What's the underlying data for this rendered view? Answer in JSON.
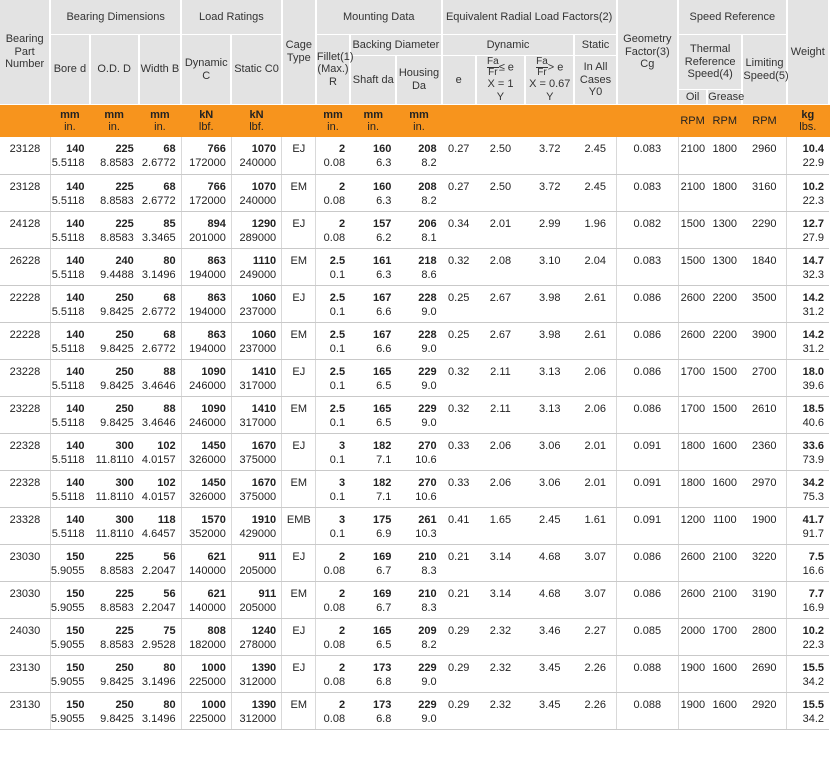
{
  "headers": {
    "part_number": "Bearing Part Number",
    "bearing_dimensions": "Bearing Dimensions",
    "load_ratings": "Load Ratings",
    "cage_type": "Cage Type",
    "mounting_data": "Mounting Data",
    "eq_radial_load_factors": "Equivalent Radial Load Factors(2)",
    "speed_reference": "Speed Reference",
    "geometry_factor": "Geometry Factor(3) Cg",
    "weight": "Weight",
    "bore": "Bore d",
    "od": "O.D. D",
    "width": "Width B",
    "dynamic_c": "Dynamic C",
    "static_c0": "Static C0",
    "fillet": "Fillet(1) (Max.) R",
    "backing_diameter": "Backing Diameter",
    "shaft": "Shaft da",
    "housing": "Housing Da",
    "dynamic": "Dynamic",
    "static": "Static",
    "e": "e",
    "fa_le_e": "≤ e",
    "fa_gt_e": "> e",
    "x1": "X = 1",
    "x067": "X = 0.67",
    "y": "Y",
    "in_all_cases": "In All Cases",
    "y0": "Y0",
    "thermal_ref": "Thermal Reference Speed(4)",
    "limiting": "Limiting Speed(5)",
    "oil": "Oil",
    "grease": "Grease",
    "fa": "Fa",
    "fr": "Fr"
  },
  "units": {
    "bore": [
      "mm",
      "in."
    ],
    "od": [
      "mm",
      "in."
    ],
    "width": [
      "mm",
      "in."
    ],
    "dynamic": [
      "kN",
      "lbf."
    ],
    "static": [
      "kN",
      "lbf."
    ],
    "fillet": [
      "mm",
      "in."
    ],
    "shaft": [
      "mm",
      "in."
    ],
    "housing": [
      "mm",
      "in."
    ],
    "rpm_oil": "RPM",
    "rpm_grease": "RPM",
    "rpm_limit": "RPM",
    "weight": [
      "kg",
      "lbs."
    ]
  },
  "rows": [
    {
      "part": "23128",
      "bore": [
        "140",
        "5.5118"
      ],
      "od": [
        "225",
        "8.8583"
      ],
      "width": [
        "68",
        "2.6772"
      ],
      "dyn": [
        "766",
        "172000"
      ],
      "stat": [
        "1070",
        "240000"
      ],
      "cage": "EJ",
      "fillet": [
        "2",
        "0.08"
      ],
      "shaft": [
        "160",
        "6.3"
      ],
      "housing": [
        "208",
        "8.2"
      ],
      "e": "0.27",
      "y1": "2.50",
      "y2": "3.72",
      "y0": "2.45",
      "cg": "0.083",
      "oil": "2100",
      "grease": "1800",
      "limit": "2960",
      "wt": [
        "10.4",
        "22.9"
      ]
    },
    {
      "part": "23128",
      "bore": [
        "140",
        "5.5118"
      ],
      "od": [
        "225",
        "8.8583"
      ],
      "width": [
        "68",
        "2.6772"
      ],
      "dyn": [
        "766",
        "172000"
      ],
      "stat": [
        "1070",
        "240000"
      ],
      "cage": "EM",
      "fillet": [
        "2",
        "0.08"
      ],
      "shaft": [
        "160",
        "6.3"
      ],
      "housing": [
        "208",
        "8.2"
      ],
      "e": "0.27",
      "y1": "2.50",
      "y2": "3.72",
      "y0": "2.45",
      "cg": "0.083",
      "oil": "2100",
      "grease": "1800",
      "limit": "3160",
      "wt": [
        "10.2",
        "22.3"
      ]
    },
    {
      "part": "24128",
      "bore": [
        "140",
        "5.5118"
      ],
      "od": [
        "225",
        "8.8583"
      ],
      "width": [
        "85",
        "3.3465"
      ],
      "dyn": [
        "894",
        "201000"
      ],
      "stat": [
        "1290",
        "289000"
      ],
      "cage": "EJ",
      "fillet": [
        "2",
        "0.08"
      ],
      "shaft": [
        "157",
        "6.2"
      ],
      "housing": [
        "206",
        "8.1"
      ],
      "e": "0.34",
      "y1": "2.01",
      "y2": "2.99",
      "y0": "1.96",
      "cg": "0.082",
      "oil": "1500",
      "grease": "1300",
      "limit": "2290",
      "wt": [
        "12.7",
        "27.9"
      ]
    },
    {
      "part": "26228",
      "bore": [
        "140",
        "5.5118"
      ],
      "od": [
        "240",
        "9.4488"
      ],
      "width": [
        "80",
        "3.1496"
      ],
      "dyn": [
        "863",
        "194000"
      ],
      "stat": [
        "1110",
        "249000"
      ],
      "cage": "EM",
      "fillet": [
        "2.5",
        "0.1"
      ],
      "shaft": [
        "161",
        "6.3"
      ],
      "housing": [
        "218",
        "8.6"
      ],
      "e": "0.32",
      "y1": "2.08",
      "y2": "3.10",
      "y0": "2.04",
      "cg": "0.083",
      "oil": "1500",
      "grease": "1300",
      "limit": "1840",
      "wt": [
        "14.7",
        "32.3"
      ]
    },
    {
      "part": "22228",
      "bore": [
        "140",
        "5.5118"
      ],
      "od": [
        "250",
        "9.8425"
      ],
      "width": [
        "68",
        "2.6772"
      ],
      "dyn": [
        "863",
        "194000"
      ],
      "stat": [
        "1060",
        "237000"
      ],
      "cage": "EJ",
      "fillet": [
        "2.5",
        "0.1"
      ],
      "shaft": [
        "167",
        "6.6"
      ],
      "housing": [
        "228",
        "9.0"
      ],
      "e": "0.25",
      "y1": "2.67",
      "y2": "3.98",
      "y0": "2.61",
      "cg": "0.086",
      "oil": "2600",
      "grease": "2200",
      "limit": "3500",
      "wt": [
        "14.2",
        "31.2"
      ]
    },
    {
      "part": "22228",
      "bore": [
        "140",
        "5.5118"
      ],
      "od": [
        "250",
        "9.8425"
      ],
      "width": [
        "68",
        "2.6772"
      ],
      "dyn": [
        "863",
        "194000"
      ],
      "stat": [
        "1060",
        "237000"
      ],
      "cage": "EM",
      "fillet": [
        "2.5",
        "0.1"
      ],
      "shaft": [
        "167",
        "6.6"
      ],
      "housing": [
        "228",
        "9.0"
      ],
      "e": "0.25",
      "y1": "2.67",
      "y2": "3.98",
      "y0": "2.61",
      "cg": "0.086",
      "oil": "2600",
      "grease": "2200",
      "limit": "3900",
      "wt": [
        "14.2",
        "31.2"
      ]
    },
    {
      "part": "23228",
      "bore": [
        "140",
        "5.5118"
      ],
      "od": [
        "250",
        "9.8425"
      ],
      "width": [
        "88",
        "3.4646"
      ],
      "dyn": [
        "1090",
        "246000"
      ],
      "stat": [
        "1410",
        "317000"
      ],
      "cage": "EJ",
      "fillet": [
        "2.5",
        "0.1"
      ],
      "shaft": [
        "165",
        "6.5"
      ],
      "housing": [
        "229",
        "9.0"
      ],
      "e": "0.32",
      "y1": "2.11",
      "y2": "3.13",
      "y0": "2.06",
      "cg": "0.086",
      "oil": "1700",
      "grease": "1500",
      "limit": "2700",
      "wt": [
        "18.0",
        "39.6"
      ]
    },
    {
      "part": "23228",
      "bore": [
        "140",
        "5.5118"
      ],
      "od": [
        "250",
        "9.8425"
      ],
      "width": [
        "88",
        "3.4646"
      ],
      "dyn": [
        "1090",
        "246000"
      ],
      "stat": [
        "1410",
        "317000"
      ],
      "cage": "EM",
      "fillet": [
        "2.5",
        "0.1"
      ],
      "shaft": [
        "165",
        "6.5"
      ],
      "housing": [
        "229",
        "9.0"
      ],
      "e": "0.32",
      "y1": "2.11",
      "y2": "3.13",
      "y0": "2.06",
      "cg": "0.086",
      "oil": "1700",
      "grease": "1500",
      "limit": "2610",
      "wt": [
        "18.5",
        "40.6"
      ]
    },
    {
      "part": "22328",
      "bore": [
        "140",
        "5.5118"
      ],
      "od": [
        "300",
        "11.8110"
      ],
      "width": [
        "102",
        "4.0157"
      ],
      "dyn": [
        "1450",
        "326000"
      ],
      "stat": [
        "1670",
        "375000"
      ],
      "cage": "EJ",
      "fillet": [
        "3",
        "0.1"
      ],
      "shaft": [
        "182",
        "7.1"
      ],
      "housing": [
        "270",
        "10.6"
      ],
      "e": "0.33",
      "y1": "2.06",
      "y2": "3.06",
      "y0": "2.01",
      "cg": "0.091",
      "oil": "1800",
      "grease": "1600",
      "limit": "2360",
      "wt": [
        "33.6",
        "73.9"
      ]
    },
    {
      "part": "22328",
      "bore": [
        "140",
        "5.5118"
      ],
      "od": [
        "300",
        "11.8110"
      ],
      "width": [
        "102",
        "4.0157"
      ],
      "dyn": [
        "1450",
        "326000"
      ],
      "stat": [
        "1670",
        "375000"
      ],
      "cage": "EM",
      "fillet": [
        "3",
        "0.1"
      ],
      "shaft": [
        "182",
        "7.1"
      ],
      "housing": [
        "270",
        "10.6"
      ],
      "e": "0.33",
      "y1": "2.06",
      "y2": "3.06",
      "y0": "2.01",
      "cg": "0.091",
      "oil": "1800",
      "grease": "1600",
      "limit": "2970",
      "wt": [
        "34.2",
        "75.3"
      ]
    },
    {
      "part": "23328",
      "bore": [
        "140",
        "5.5118"
      ],
      "od": [
        "300",
        "11.8110"
      ],
      "width": [
        "118",
        "4.6457"
      ],
      "dyn": [
        "1570",
        "352000"
      ],
      "stat": [
        "1910",
        "429000"
      ],
      "cage": "EMB",
      "fillet": [
        "3",
        "0.1"
      ],
      "shaft": [
        "175",
        "6.9"
      ],
      "housing": [
        "261",
        "10.3"
      ],
      "e": "0.41",
      "y1": "1.65",
      "y2": "2.45",
      "y0": "1.61",
      "cg": "0.091",
      "oil": "1200",
      "grease": "1100",
      "limit": "1900",
      "wt": [
        "41.7",
        "91.7"
      ]
    },
    {
      "part": "23030",
      "bore": [
        "150",
        "5.9055"
      ],
      "od": [
        "225",
        "8.8583"
      ],
      "width": [
        "56",
        "2.2047"
      ],
      "dyn": [
        "621",
        "140000"
      ],
      "stat": [
        "911",
        "205000"
      ],
      "cage": "EJ",
      "fillet": [
        "2",
        "0.08"
      ],
      "shaft": [
        "169",
        "6.7"
      ],
      "housing": [
        "210",
        "8.3"
      ],
      "e": "0.21",
      "y1": "3.14",
      "y2": "4.68",
      "y0": "3.07",
      "cg": "0.086",
      "oil": "2600",
      "grease": "2100",
      "limit": "3220",
      "wt": [
        "7.5",
        "16.6"
      ]
    },
    {
      "part": "23030",
      "bore": [
        "150",
        "5.9055"
      ],
      "od": [
        "225",
        "8.8583"
      ],
      "width": [
        "56",
        "2.2047"
      ],
      "dyn": [
        "621",
        "140000"
      ],
      "stat": [
        "911",
        "205000"
      ],
      "cage": "EM",
      "fillet": [
        "2",
        "0.08"
      ],
      "shaft": [
        "169",
        "6.7"
      ],
      "housing": [
        "210",
        "8.3"
      ],
      "e": "0.21",
      "y1": "3.14",
      "y2": "4.68",
      "y0": "3.07",
      "cg": "0.086",
      "oil": "2600",
      "grease": "2100",
      "limit": "3190",
      "wt": [
        "7.7",
        "16.9"
      ]
    },
    {
      "part": "24030",
      "bore": [
        "150",
        "5.9055"
      ],
      "od": [
        "225",
        "8.8583"
      ],
      "width": [
        "75",
        "2.9528"
      ],
      "dyn": [
        "808",
        "182000"
      ],
      "stat": [
        "1240",
        "278000"
      ],
      "cage": "EJ",
      "fillet": [
        "2",
        "0.08"
      ],
      "shaft": [
        "165",
        "6.5"
      ],
      "housing": [
        "209",
        "8.2"
      ],
      "e": "0.29",
      "y1": "2.32",
      "y2": "3.46",
      "y0": "2.27",
      "cg": "0.085",
      "oil": "2000",
      "grease": "1700",
      "limit": "2800",
      "wt": [
        "10.2",
        "22.3"
      ]
    },
    {
      "part": "23130",
      "bore": [
        "150",
        "5.9055"
      ],
      "od": [
        "250",
        "9.8425"
      ],
      "width": [
        "80",
        "3.1496"
      ],
      "dyn": [
        "1000",
        "225000"
      ],
      "stat": [
        "1390",
        "312000"
      ],
      "cage": "EJ",
      "fillet": [
        "2",
        "0.08"
      ],
      "shaft": [
        "173",
        "6.8"
      ],
      "housing": [
        "229",
        "9.0"
      ],
      "e": "0.29",
      "y1": "2.32",
      "y2": "3.45",
      "y0": "2.26",
      "cg": "0.088",
      "oil": "1900",
      "grease": "1600",
      "limit": "2690",
      "wt": [
        "15.5",
        "34.2"
      ]
    },
    {
      "part": "23130",
      "bore": [
        "150",
        "5.9055"
      ],
      "od": [
        "250",
        "9.8425"
      ],
      "width": [
        "80",
        "3.1496"
      ],
      "dyn": [
        "1000",
        "225000"
      ],
      "stat": [
        "1390",
        "312000"
      ],
      "cage": "EM",
      "fillet": [
        "2",
        "0.08"
      ],
      "shaft": [
        "173",
        "6.8"
      ],
      "housing": [
        "229",
        "9.0"
      ],
      "e": "0.29",
      "y1": "2.32",
      "y2": "3.45",
      "y0": "2.26",
      "cg": "0.088",
      "oil": "1900",
      "grease": "1600",
      "limit": "2920",
      "wt": [
        "15.5",
        "34.2"
      ]
    }
  ]
}
